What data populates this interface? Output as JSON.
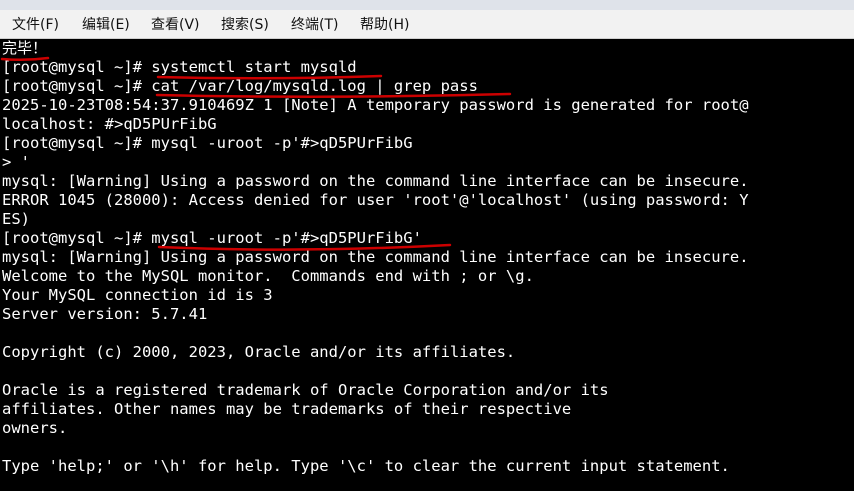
{
  "menubar": {
    "items": [
      "文件(F)",
      "编辑(E)",
      "查看(V)",
      "搜索(S)",
      "终端(T)",
      "帮助(H)"
    ]
  },
  "terminal": {
    "lines": [
      "完毕！",
      "[root@mysql ~]# systemctl start mysqld",
      "[root@mysql ~]# cat /var/log/mysqld.log | grep pass",
      "2025-10-23T08:54:37.910469Z 1 [Note] A temporary password is generated for root@",
      "localhost: #>qD5PUrFibG",
      "[root@mysql ~]# mysql -uroot -p'#>qD5PUrFibG",
      "> '",
      "mysql: [Warning] Using a password on the command line interface can be insecure.",
      "ERROR 1045 (28000): Access denied for user 'root'@'localhost' (using password: Y",
      "ES)",
      "[root@mysql ~]# mysql -uroot -p'#>qD5PUrFibG'",
      "mysql: [Warning] Using a password on the command line interface can be insecure.",
      "Welcome to the MySQL monitor.  Commands end with ; or \\g.",
      "Your MySQL connection id is 3",
      "Server version: 5.7.41",
      "",
      "Copyright (c) 2000, 2023, Oracle and/or its affiliates.",
      "",
      "Oracle is a registered trademark of Oracle Corporation and/or its",
      "affiliates. Other names may be trademarks of their respective",
      "owners.",
      "",
      "Type 'help;' or '\\h' for help. Type '\\c' to clear the current input statement."
    ]
  },
  "annotations": {
    "color": "#cc0000"
  }
}
